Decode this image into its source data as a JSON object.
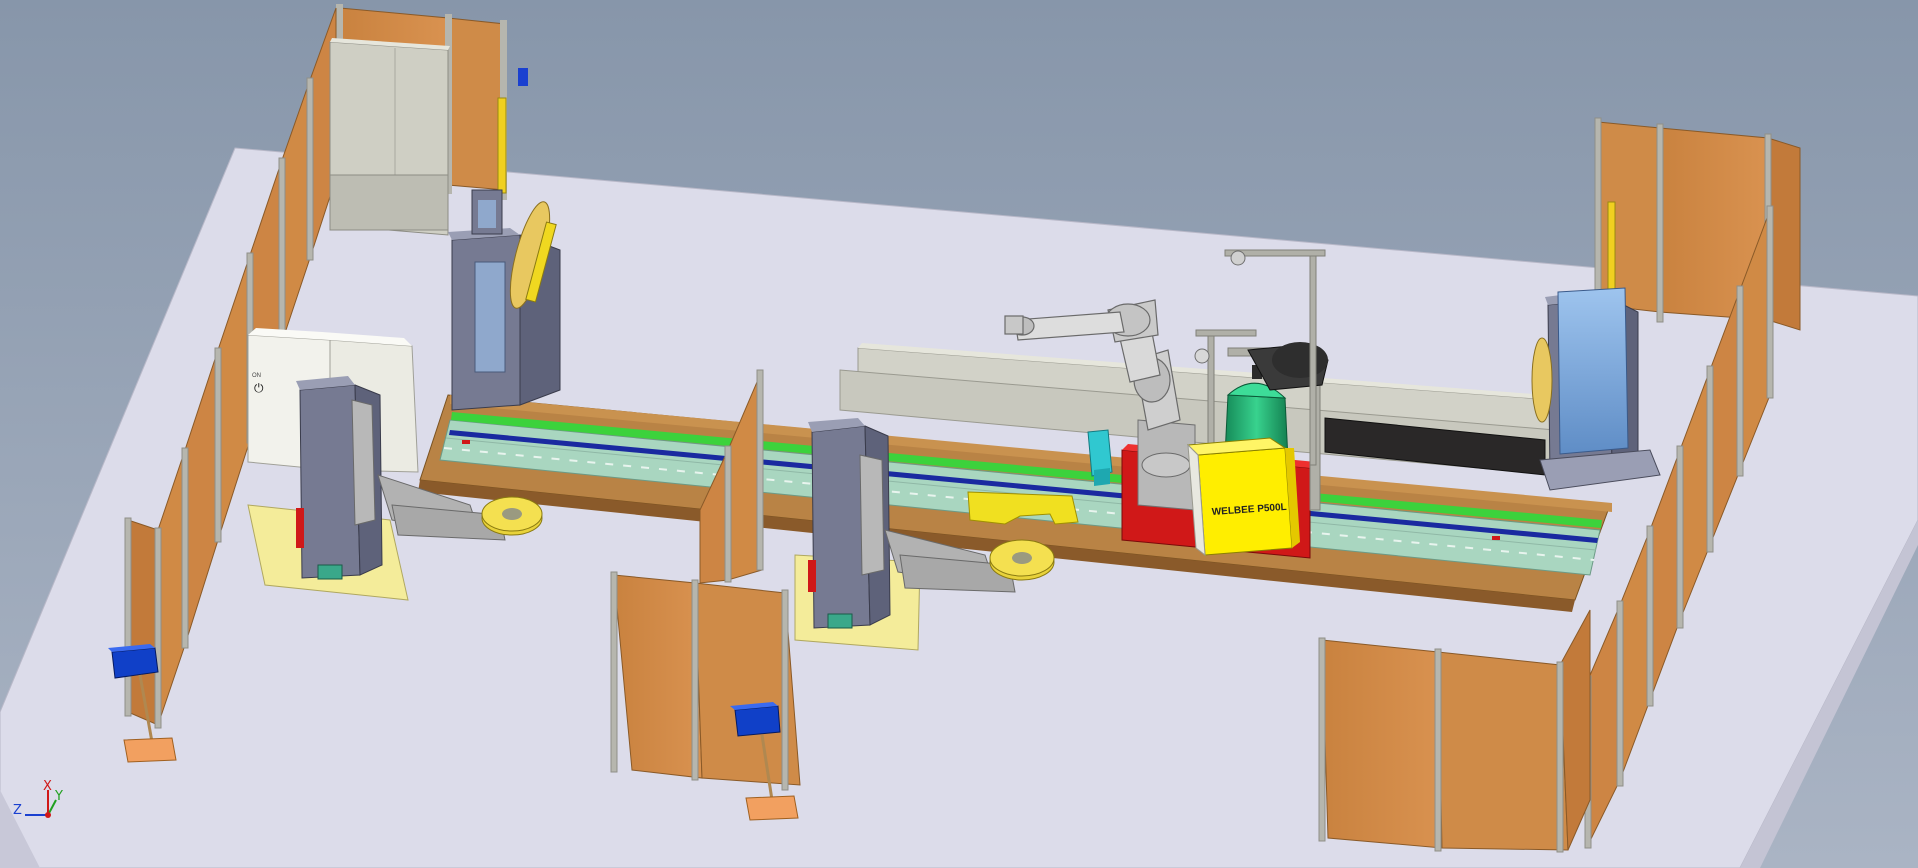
{
  "scene": {
    "welder_label": "WELBEE P500L",
    "cabinet_small_label": "ON",
    "cabinet_symbol": "⏻"
  },
  "triad": {
    "x_label": "X",
    "y_label": "Y",
    "z_label": "Z"
  },
  "colors": {
    "background": "#8a9aaf",
    "floor": "#dcdcea",
    "fence_panel": "#d08a45",
    "fence_post": "#b8b8b0",
    "rail_base": "#b07a3a",
    "rail_green": "#3cd23c",
    "rail_blue": "#1a2aa0",
    "rail_bed": "#a9d6c0",
    "positioner_body": "#6f738c",
    "turntable": "#e8d23a",
    "welder": "#ffee00",
    "torch_cleaner": "#30c8d0",
    "wire_drum": "#20b070",
    "red_base": "#d01818",
    "button_box": "#1040c8"
  },
  "icons": [
    "axis-triad-icon"
  ]
}
